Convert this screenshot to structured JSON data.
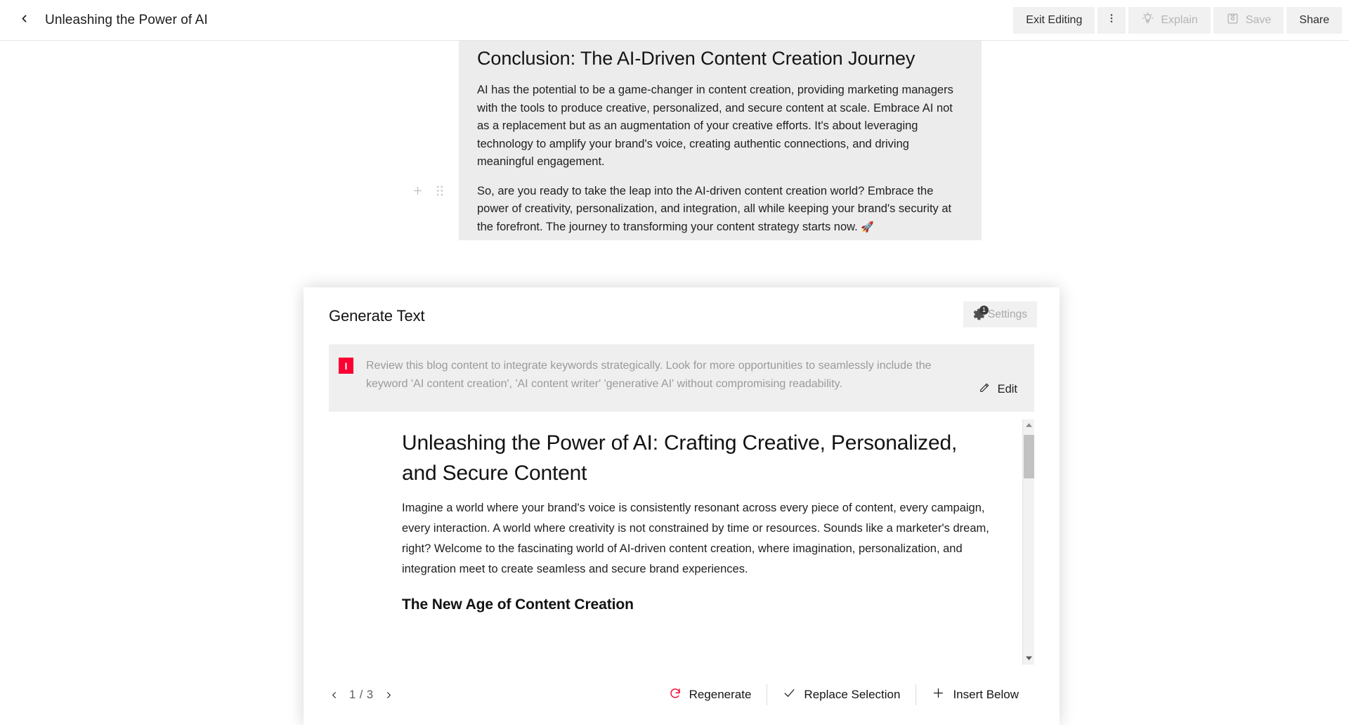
{
  "topbar": {
    "back_icon": "chevron-left-icon",
    "title": "Unleashing the Power of AI",
    "exit_editing_label": "Exit Editing",
    "more_icon": "more-vertical-icon",
    "explain_label": "Explain",
    "explain_icon": "lightbulb-icon",
    "save_label": "Save",
    "save_icon": "floppy-disk-icon",
    "share_label": "Share"
  },
  "document": {
    "heading": "Conclusion: The AI-Driven Content Creation Journey",
    "paragraph_1": "AI has the potential to be a game-changer in content creation, providing marketing managers with the tools to produce creative, personalized, and secure content at scale. Embrace AI not as a replacement but as an augmentation of your creative efforts. It's about leveraging technology to amplify your brand's voice, creating authentic connections, and driving meaningful engagement.",
    "paragraph_2": "So, are you ready to take the leap into the AI-driven content creation world? Embrace the power of creativity, personalization, and integration, all while keeping your brand's security at the forefront. The journey to transforming your content strategy starts now. ",
    "paragraph_2_emoji": "🚀",
    "add_block_icon": "plus-icon",
    "drag_handle_icon": "drag-handle-icon"
  },
  "modal": {
    "title": "Generate Text",
    "settings_label": "Settings",
    "settings_icon": "gear-icon",
    "settings_badge": "1",
    "prompt_marker": "I",
    "prompt_text": "Review this blog content to integrate keywords strategically. Look for more opportunities to seamlessly include the keyword 'AI content creation', 'AI content writer' 'generative AI' without compromising readability.",
    "edit_label": "Edit",
    "edit_icon": "pencil-icon",
    "preview": {
      "heading": "Unleashing the Power of AI: Crafting Creative, Personalized, and Secure Content",
      "paragraph": "Imagine a world where your brand's voice is consistently resonant across every piece of content, every campaign, every interaction. A world where creativity is not constrained by time or resources. Sounds like a marketer's dream, right? Welcome to the fascinating world of AI-driven content creation, where imagination, personalization, and integration meet to create seamless and secure brand experiences.",
      "subheading": "The New Age of Content Creation"
    },
    "footer": {
      "prev_icon": "chevron-left-icon",
      "page_label": "1 / 3",
      "next_icon": "chevron-right-icon",
      "regenerate_label": "Regenerate",
      "regenerate_icon": "refresh-icon",
      "replace_label": "Replace Selection",
      "replace_icon": "check-icon",
      "insert_label": "Insert Below",
      "insert_icon": "plus-icon"
    }
  },
  "colors": {
    "accent_red": "#fb0033",
    "button_bg": "#f1f1f1",
    "selection_bg": "#ececec"
  }
}
